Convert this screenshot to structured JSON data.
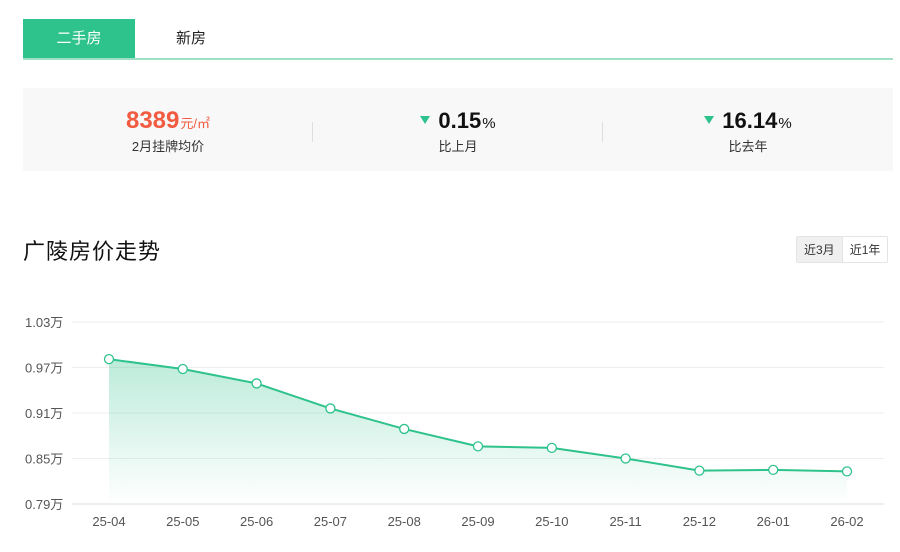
{
  "tabs": [
    {
      "label": "二手房",
      "active": true
    },
    {
      "label": "新房",
      "active": false
    }
  ],
  "summary": {
    "price": {
      "value": "8389",
      "unit": "元/㎡",
      "label": "2月挂牌均价"
    },
    "mom": {
      "value": "0.15",
      "unit": "%",
      "label": "比上月",
      "direction": "down"
    },
    "yoy": {
      "value": "16.14",
      "unit": "%",
      "label": "比去年",
      "direction": "down"
    }
  },
  "section_title": "广陵房价走势",
  "range_options": [
    {
      "label": "近3月",
      "active": true
    },
    {
      "label": "近1年",
      "active": false
    }
  ],
  "colors": {
    "accent": "#2ec28c",
    "price": "#f15b40"
  },
  "chart_data": {
    "type": "area",
    "categories": [
      "25-04",
      "25-05",
      "25-06",
      "25-07",
      "25-08",
      "25-09",
      "25-10",
      "25-11",
      "25-12",
      "26-01",
      "26-02"
    ],
    "values": [
      0.981,
      0.968,
      0.949,
      0.916,
      0.889,
      0.866,
      0.864,
      0.85,
      0.834,
      0.835,
      0.833
    ],
    "y_ticks": [
      "0.79万",
      "0.85万",
      "0.91万",
      "0.97万",
      "1.03万"
    ],
    "y_tick_values": [
      0.79,
      0.85,
      0.91,
      0.97,
      1.03
    ],
    "ylim": [
      0.79,
      1.03
    ],
    "title": "",
    "xlabel": "",
    "ylabel": "",
    "grid": true
  }
}
